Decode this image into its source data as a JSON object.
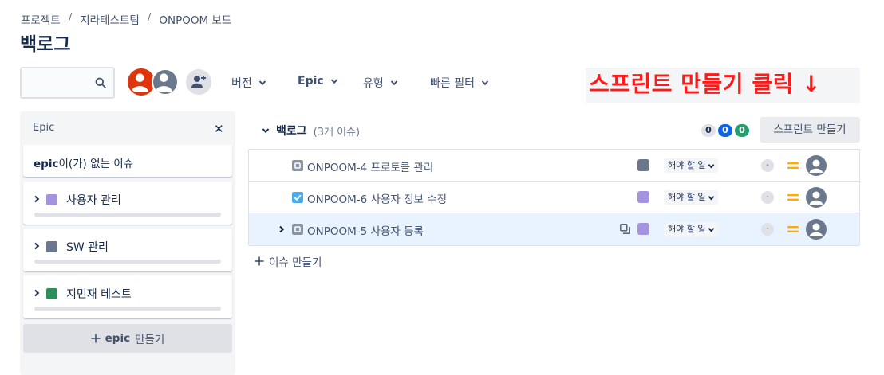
{
  "breadcrumb": {
    "items": [
      "프로젝트",
      "지라테스트팀",
      "ONPOOM 보드"
    ],
    "separator": "/"
  },
  "page_title": "백로그",
  "search": {
    "placeholder": ""
  },
  "filters": [
    {
      "label": "버전"
    },
    {
      "label": "Epic"
    },
    {
      "label": "유형"
    },
    {
      "label": "빠른 필터"
    }
  ],
  "callout": {
    "text": "스프린트 만들기 클릭 ↓",
    "color": "#ff1a1a"
  },
  "epic_panel": {
    "header": "Epic",
    "no_epic_bold": "epic",
    "no_epic_rest": "이(가) 없는 이슈",
    "epics": [
      {
        "name": "사용자 관리",
        "color": "#a593e0"
      },
      {
        "name": "SW 관리",
        "color": "#6b778c"
      },
      {
        "name": "지민재 테스트",
        "color": "#2f8f5b"
      }
    ],
    "create_bold": "epic",
    "create_rest": "만들기"
  },
  "backlog": {
    "label": "백로그",
    "count": "(3개 이슈)",
    "lozenges": [
      {
        "value": "0",
        "bg": "#dfe1e6",
        "fg": "#172b4d"
      },
      {
        "value": "0",
        "bg": "#0c66e4",
        "fg": "#ffffff"
      },
      {
        "value": "0",
        "bg": "#22a06b",
        "fg": "#ffffff"
      }
    ],
    "create_sprint": "스프린트 만들기",
    "issues": [
      {
        "key_summary": "ONPOOM-4 프로토콜 관리",
        "type": "task-icon",
        "type_color": "#8993a4",
        "epic_color": "#6b778c",
        "status": "해야 할 일",
        "estimate": "-",
        "has_subtask": false,
        "expandable": false,
        "selected": false
      },
      {
        "key_summary": "ONPOOM-6 사용자 정보 수정",
        "type": "checkbox-icon",
        "type_color": "#4bade8",
        "epic_color": "#a593e0",
        "status": "해야 할 일",
        "estimate": "-",
        "has_subtask": false,
        "expandable": false,
        "selected": false
      },
      {
        "key_summary": "ONPOOM-5 사용자 등록",
        "type": "task-icon",
        "type_color": "#8993a4",
        "epic_color": "#a593e0",
        "status": "해야 할 일",
        "estimate": "-",
        "has_subtask": true,
        "expandable": true,
        "selected": true
      }
    ],
    "create_issue": "이슈 만들기",
    "priority_color": "#ffab00"
  }
}
